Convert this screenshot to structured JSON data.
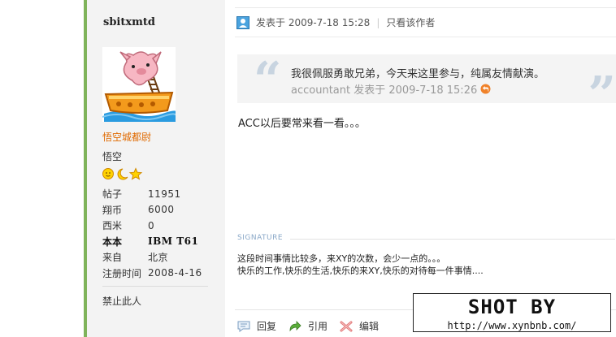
{
  "profile": {
    "username": "sbitxmtd",
    "rank_title": "悟空城都尉",
    "rank_name": "悟空",
    "rank_icons": [
      "sun-icon",
      "moon-icon",
      "star-icon"
    ],
    "stats": [
      {
        "label": "帖子",
        "value": "11951"
      },
      {
        "label": "翔币",
        "value": "6000"
      },
      {
        "label": "西米",
        "value": "0"
      },
      {
        "label": "本本",
        "value": "IBM T61"
      },
      {
        "label": "来自",
        "value": "北京"
      },
      {
        "label": "注册时间",
        "value": "2008-4-16"
      }
    ],
    "ban_label": "禁止此人"
  },
  "post": {
    "meta_text": "发表于 2009-7-18 15:28",
    "separator": "|",
    "only_author_label": "只看该作者",
    "quote": {
      "text": "我很佩服勇敢兄弟，今天来这里参与，纯属友情献演。",
      "author": "accountant 发表于 2009-7-18 15:26"
    },
    "body": "ACC以后要常来看一看。。。",
    "signature": {
      "label": "SIGNATURE",
      "line1": "这段时间事情比较多，来XY的次数，会少一点的。。。",
      "line2": "快乐的工作,快乐的生活,快乐的来XY,快乐的对待每一件事情...."
    },
    "actions": {
      "reply": "回复",
      "quote": "引用",
      "edit": "编辑"
    }
  },
  "watermark": {
    "title": "SHOT BY",
    "url": "http://www.xynbnb.com/"
  },
  "colors": {
    "accent_green": "#7fb35a",
    "rank_orange": "#e06a00",
    "sidebar_bg": "#f3f3f3",
    "quote_bg": "#f4f4f4"
  }
}
